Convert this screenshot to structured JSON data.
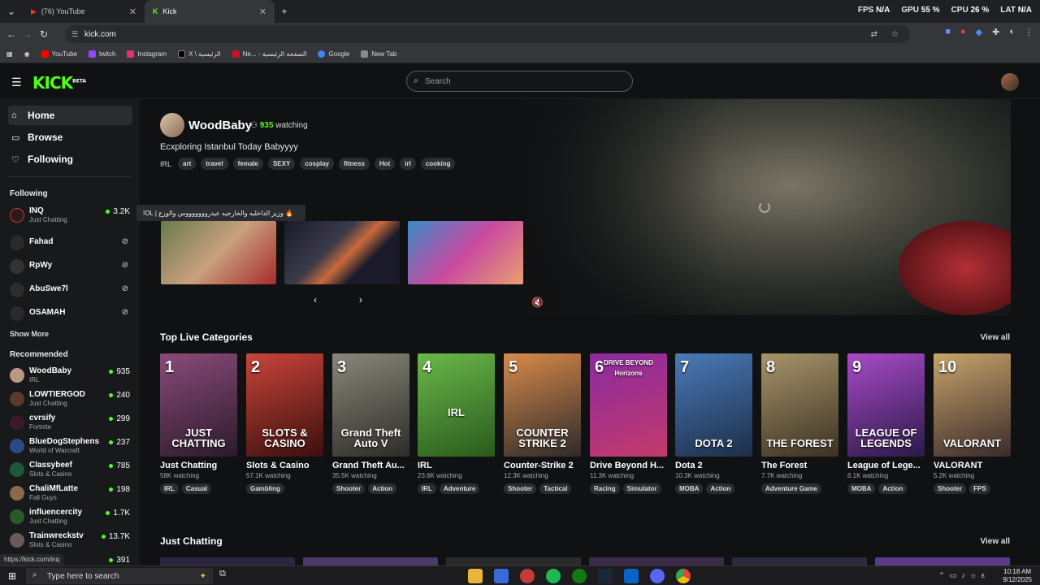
{
  "browser": {
    "tabs": [
      {
        "title": "(76) YouTube",
        "active": false
      },
      {
        "title": "Kick",
        "active": true
      }
    ],
    "new_tab": "+",
    "url": "kick.com",
    "bookmarks": [
      {
        "label": "YouTube",
        "color": "#ff0000"
      },
      {
        "label": "twitch",
        "color": "#9146ff"
      },
      {
        "label": "Instagram",
        "color": "#e1306c"
      },
      {
        "label": "X \\ الرئيسية",
        "color": "#000000"
      },
      {
        "label": "Ne... - الصفحة الرئيسية",
        "color": "#c4122f"
      },
      {
        "label": "Google",
        "color": "#4285f4"
      },
      {
        "label": "New Tab",
        "color": "#888888"
      }
    ],
    "status_url": "https://kick.com/inq"
  },
  "hud": {
    "fps_label": "FPS",
    "fps": "N/A",
    "gpu_label": "GPU",
    "gpu": "55 %",
    "cpu_label": "CPU",
    "cpu": "26 %",
    "lat_label": "LAT",
    "lat": "N/A"
  },
  "site": {
    "logo": "KICK",
    "logo_badge": "BETA",
    "search_placeholder": "Search",
    "accent": "#53fc18"
  },
  "sidebar": {
    "nav": [
      {
        "label": "Home",
        "icon": "home-icon"
      },
      {
        "label": "Browse",
        "icon": "browse-icon"
      },
      {
        "label": "Following",
        "icon": "heart-icon"
      }
    ],
    "following_title": "Following",
    "following": [
      {
        "name": "INQ",
        "category": "Just Chatting",
        "viewers": "3.2K",
        "live": true
      },
      {
        "name": "Fahad",
        "live": false
      },
      {
        "name": "RpWy",
        "live": false
      },
      {
        "name": "AbuSwe7l",
        "live": false
      },
      {
        "name": "OSAMAH",
        "live": false
      }
    ],
    "show_more": "Show More",
    "recommended_title": "Recommended",
    "recommended": [
      {
        "name": "WoodBaby",
        "category": "IRL",
        "viewers": "935"
      },
      {
        "name": "LOWTIERGOD",
        "category": "Just Chatting",
        "viewers": "240"
      },
      {
        "name": "cvrsify",
        "category": "Fortnite",
        "viewers": "299"
      },
      {
        "name": "BlueDogStephens",
        "category": "World of Warcraft",
        "viewers": "237"
      },
      {
        "name": "Classybeef",
        "category": "Slots & Casino",
        "viewers": "785"
      },
      {
        "name": "ChaliMfLatte",
        "category": "Fall Guys",
        "viewers": "198"
      },
      {
        "name": "influencercity",
        "category": "Just Chatting",
        "viewers": "1.7K"
      },
      {
        "name": "Trainwreckstv",
        "category": "Slots & Casino",
        "viewers": "13.7K"
      },
      {
        "name": "",
        "category": "",
        "viewers": "391"
      }
    ],
    "tooltip": "!OL | وزير الداخليه والخارجيه عيدروووووووس والوزع 🔥"
  },
  "hero": {
    "streamer": "WoodBaby",
    "watching_count": "935",
    "watching_label": "watching",
    "title": "Ecxploring Istanbul Today Babyyyy",
    "language": "IRL",
    "tags": [
      "art",
      "travel",
      "female",
      "SEXY",
      "cosplay",
      "fitness",
      "Hot",
      "irl",
      "cooking"
    ]
  },
  "categories_section": {
    "title": "Top Live Categories",
    "view_all": "View all",
    "items": [
      {
        "rank": "1",
        "name": "Just Chatting",
        "watching": "58K watching",
        "tags": [
          "IRL",
          "Casual"
        ],
        "art": "JUST CHATTING",
        "color1": "#6a3a5e",
        "color2": "#2b1b2a"
      },
      {
        "rank": "2",
        "name": "Slots & Casino",
        "watching": "57.1K watching",
        "tags": [
          "Gambling"
        ],
        "art": "SLOTS & CASINO",
        "color1": "#b8342c",
        "color2": "#3c0f0d"
      },
      {
        "rank": "3",
        "name": "Grand Theft Au...",
        "watching": "35.5K watching",
        "tags": [
          "Shooter",
          "Action"
        ],
        "art": "Grand Theft Auto V",
        "color1": "#6e6a60",
        "color2": "#2e2c28"
      },
      {
        "rank": "4",
        "name": "IRL",
        "watching": "23.6K watching",
        "tags": [
          "IRL",
          "Adventure"
        ],
        "art": "IRL",
        "color1": "#59a83a",
        "color2": "#2a5a1c"
      },
      {
        "rank": "5",
        "name": "Counter-Strike 2",
        "watching": "12.3K watching",
        "tags": [
          "Shooter",
          "Tactical"
        ],
        "art": "COUNTER STRIKE 2",
        "color1": "#c47a3a",
        "color2": "#2d2a2a"
      },
      {
        "rank": "6",
        "name": "Drive Beyond H...",
        "watching": "11.3K watching",
        "tags": [
          "Racing",
          "Simulator"
        ],
        "art": "DRIVE BEYOND Horizons",
        "color1": "#8a2aa0",
        "color2": "#c43a6a"
      },
      {
        "rank": "7",
        "name": "Dota 2",
        "watching": "10.3K watching",
        "tags": [
          "MOBA",
          "Action"
        ],
        "art": "DOTA 2",
        "color1": "#3a6aa8",
        "color2": "#1c2e48"
      },
      {
        "rank": "8",
        "name": "The Forest",
        "watching": "7.7K watching",
        "tags": [
          "Adventure Game"
        ],
        "art": "THE FOREST",
        "color1": "#8a7a5a",
        "color2": "#3a3222"
      },
      {
        "rank": "9",
        "name": "League of Lege...",
        "watching": "6.1K watching",
        "tags": [
          "MOBA",
          "Action"
        ],
        "art": "LEAGUE OF LEGENDS",
        "color1": "#8a3aa8",
        "color2": "#2a1a48"
      },
      {
        "rank": "10",
        "name": "VALORANT",
        "watching": "5.2K watching",
        "tags": [
          "Shooter",
          "FPS"
        ],
        "art": "VALORANT",
        "color1": "#a8885a",
        "color2": "#3a2a2a"
      }
    ]
  },
  "just_chatting_section": {
    "title": "Just Chatting",
    "view_all": "View all"
  },
  "taskbar": {
    "search_placeholder": "Type here to search",
    "time": "10:18 AM",
    "date": "9/12/2025"
  }
}
